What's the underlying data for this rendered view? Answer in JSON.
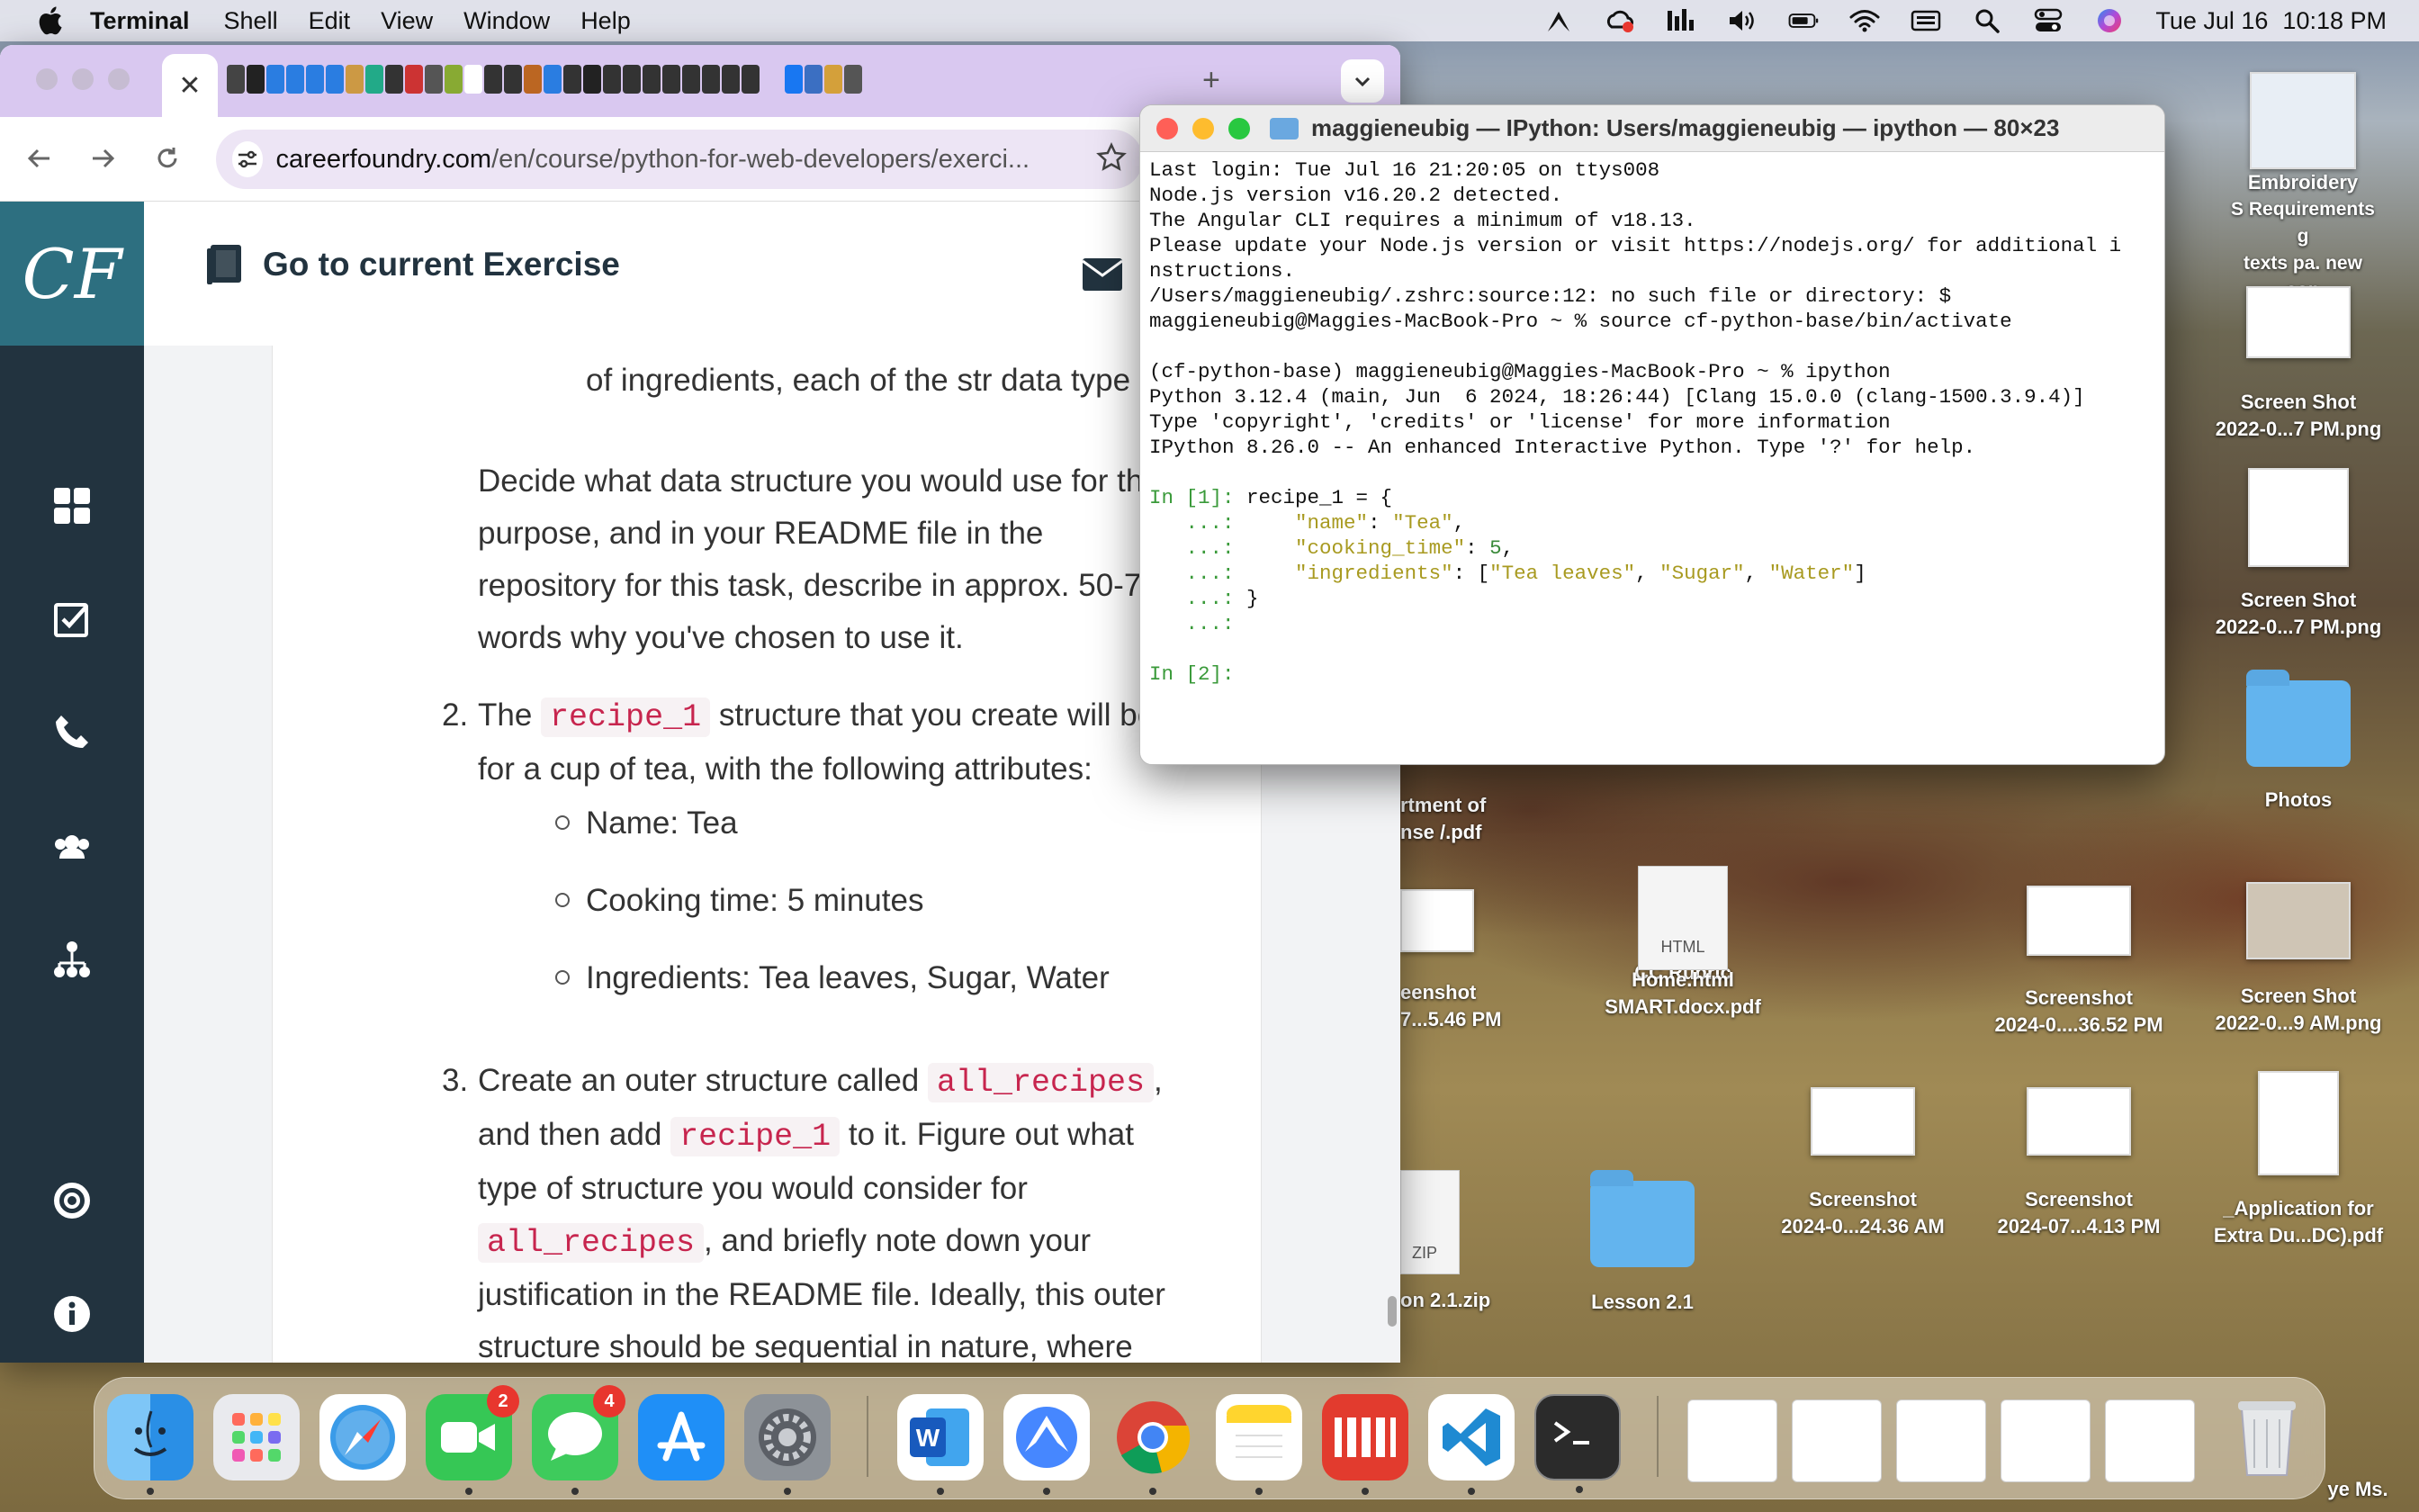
{
  "menubar": {
    "app_name": "Terminal",
    "items": [
      "Shell",
      "Edit",
      "View",
      "Window",
      "Help"
    ],
    "date": "Tue Jul 16",
    "time": "10:18 PM"
  },
  "browser": {
    "url_host": "careerfoundry.com",
    "url_path": "/en/course/python-for-web-developers/exerci...",
    "header_title": "Go to current Exercise",
    "logo_text": "CF",
    "sidebar_icons": [
      "dashboard-icon",
      "checklist-icon",
      "phone-icon",
      "community-icon",
      "network-icon",
      "help-icon",
      "info-icon"
    ],
    "article": {
      "line1": "of ingredients, each of the str data type",
      "p1_lines": [
        "Decide what data structure you would use for thi",
        "purpose, and in your README file in the",
        "repository for this task, describe in approx. 50-75",
        "words why you've chosen to use it."
      ],
      "item2_number": "2.",
      "item2_pre": "The",
      "item2_code": "recipe_1",
      "item2_post": "structure that you create will be",
      "item2_line2": "for a cup of tea, with the following attributes:",
      "bullets": [
        "Name: Tea",
        "Cooking time: 5 minutes",
        "Ingredients: Tea leaves, Sugar, Water"
      ],
      "item3_number": "3.",
      "item3_pre": "Create an outer structure called",
      "item3_code1": "all_recipes",
      "item3_comma": ",",
      "item3_l2_pre": "and then add",
      "item3_code2": "recipe_1",
      "item3_l2_post": "to it. Figure out what",
      "item3_l3": "type of structure you would consider for",
      "item3_code3": "all_recipes",
      "item3_l4_post": ", and briefly note down your",
      "item3_l5": "justification in the README file. Ideally, this outer",
      "item3_l6": "structure should be sequential in nature, where"
    }
  },
  "terminal": {
    "title": "maggieneubig — IPython: Users/maggieneubig — ipython — 80×23",
    "lines": [
      "Last login: Tue Jul 16 21:20:05 on ttys008",
      "Node.js version v16.20.2 detected.",
      "The Angular CLI requires a minimum of v18.13.",
      "",
      "Please update your Node.js version or visit https://nodejs.org/ for additional i",
      "nstructions.",
      "/Users/maggieneubig/.zshrc:source:12: no such file or directory: $",
      "maggieneubig@Maggies-MacBook-Pro ~ % source cf-python-base/bin/activate",
      "",
      "(cf-python-base) maggieneubig@Maggies-MacBook-Pro ~ % ipython",
      "Python 3.12.4 (main, Jun  6 2024, 18:26:44) [Clang 15.0.0 (clang-1500.3.9.4)]",
      "Type 'copyright', 'credits' or 'license' for more information",
      "IPython 8.26.0 -- An enhanced Interactive Python. Type '?' for help.",
      ""
    ],
    "prompt1": "In [1]:",
    "cont": "...:",
    "code_open": "recipe_1 = {",
    "key_name": "\"name\"",
    "val_name": "\"Tea\"",
    "key_time": "\"cooking_time\"",
    "val_time": "5",
    "key_ingr": "\"ingredients\"",
    "ingr_1": "\"Tea leaves\"",
    "ingr_2": "\"Sugar\"",
    "ingr_3": "\"Water\"",
    "code_close": "}",
    "prompt2": "In [2]:"
  },
  "desktop": {
    "icons": [
      {
        "label1": "Embroidery",
        "label2": "S Requirements g"
      },
      {
        "label1": "texts pa. new sop",
        "label2": ""
      },
      {
        "label1": "Screen Shot",
        "label2": "2022-0...7 PM.png"
      },
      {
        "label1": "Screen Shot",
        "label2": "2022-0...7 PM.png"
      },
      {
        "label1": "Photos",
        "label2": ""
      },
      {
        "label1": "rtment of",
        "label2": "nse /.pdf"
      },
      {
        "label1": "eenshot",
        "label2": "7...5.46 PM"
      },
      {
        "label1": "Home.html",
        "label2": "SMART.docx.pdf",
        "label0": "CC Rubric"
      },
      {
        "label1": "Screenshot",
        "label2": "2024-0....36.52 PM"
      },
      {
        "label1": "Screen Shot",
        "label2": "2022-0...9 AM.png"
      },
      {
        "label1": "Screenshot",
        "label2": "2024-0...24.36 AM"
      },
      {
        "label1": "Screenshot",
        "label2": "2024-07...4.13 PM"
      },
      {
        "label1": "_Application for",
        "label2": "Extra Du...DC).pdf"
      },
      {
        "label1": "on 2.1.zip",
        "label2": ""
      },
      {
        "label1": "Lesson 2.1",
        "label2": ""
      },
      {
        "label1": "ye Ms.",
        "label2": ""
      }
    ],
    "file_badge_html": "HTML",
    "file_badge_zip": "ZIP"
  },
  "dock": {
    "apps": [
      "Finder",
      "Launchpad",
      "Safari",
      "FaceTime",
      "Messages",
      "App Store",
      "System Settings",
      "Microsoft Word",
      "NordVPN",
      "Google Chrome",
      "Notes",
      "Mimestream",
      "Visual Studio Code",
      "Terminal"
    ],
    "facetime_badge": "2",
    "messages_badge": "4"
  }
}
